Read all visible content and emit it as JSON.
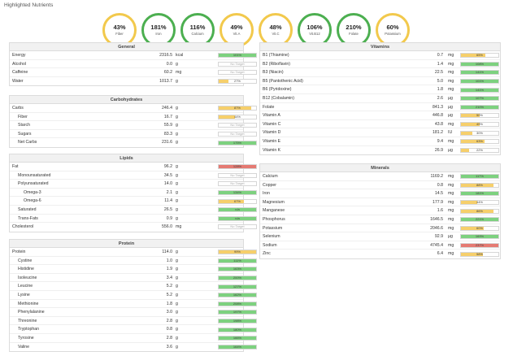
{
  "title": "Highlighted Nutrients",
  "highlights": [
    {
      "pct": "43%",
      "name": "Fiber",
      "color": "#f2c94c"
    },
    {
      "pct": "181%",
      "name": "Iron",
      "color": "#4caf50"
    },
    {
      "pct": "116%",
      "name": "Calcium",
      "color": "#4caf50"
    },
    {
      "pct": "49%",
      "name": "Vit.A",
      "color": "#f2c94c"
    },
    {
      "pct": "48%",
      "name": "Vit.C",
      "color": "#f2c94c"
    },
    {
      "pct": "106%",
      "name": "Vit.B12",
      "color": "#4caf50"
    },
    {
      "pct": "210%",
      "name": "Folate",
      "color": "#4caf50"
    },
    {
      "pct": "60%",
      "name": "Potassium",
      "color": "#f2c94c"
    }
  ],
  "sections": {
    "general": {
      "title": "General",
      "rows": [
        {
          "name": "Energy",
          "amount": "2316.5",
          "unit": "kcal",
          "pct": 101,
          "bar": "101%",
          "status": "green",
          "indent": 0
        },
        {
          "name": "Alcohol",
          "amount": "0.0",
          "unit": "g",
          "pct": 0,
          "bar": "No Target",
          "status": "none",
          "indent": 0
        },
        {
          "name": "Caffeine",
          "amount": "60.2",
          "unit": "mg",
          "pct": 0,
          "bar": "No Target",
          "status": "none",
          "indent": 0
        },
        {
          "name": "Water",
          "amount": "1013.7",
          "unit": "g",
          "pct": 27,
          "bar": "27%",
          "status": "yellow",
          "indent": 0
        }
      ]
    },
    "carbohydrates": {
      "title": "Carbohydrates",
      "rows": [
        {
          "name": "Carbs",
          "amount": "246.4",
          "unit": "g",
          "pct": 87,
          "bar": "87%",
          "status": "yellow",
          "indent": 0
        },
        {
          "name": "Fiber",
          "amount": "16.7",
          "unit": "g",
          "pct": 44,
          "bar": "44%",
          "status": "yellow",
          "indent": 1
        },
        {
          "name": "Starch",
          "amount": "55.9",
          "unit": "g",
          "pct": 0,
          "bar": "No Target",
          "status": "none",
          "indent": 1
        },
        {
          "name": "Sugars",
          "amount": "83.3",
          "unit": "g",
          "pct": 0,
          "bar": "No Target",
          "status": "none",
          "indent": 1
        },
        {
          "name": "Net Carbs",
          "amount": "231.6",
          "unit": "g",
          "pct": 100,
          "bar": "175%",
          "status": "green",
          "indent": 1
        }
      ]
    },
    "lipids": {
      "title": "Lipids",
      "rows": [
        {
          "name": "Fat",
          "amount": "96.2",
          "unit": "g",
          "pct": 100,
          "bar": "128%",
          "status": "red",
          "indent": 0
        },
        {
          "name": "Monounsaturated",
          "amount": "34.5",
          "unit": "g",
          "pct": 0,
          "bar": "No Target",
          "status": "none",
          "indent": 1
        },
        {
          "name": "Polyunsaturated",
          "amount": "14.0",
          "unit": "g",
          "pct": 0,
          "bar": "No Target",
          "status": "none",
          "indent": 1
        },
        {
          "name": "Omega-3",
          "amount": "2.1",
          "unit": "g",
          "pct": 100,
          "bar": "134%",
          "status": "green",
          "indent": 2
        },
        {
          "name": "Omega-6",
          "amount": "11.4",
          "unit": "g",
          "pct": 67,
          "bar": "67%",
          "status": "yellow",
          "indent": 2
        },
        {
          "name": "Saturated",
          "amount": "26.5",
          "unit": "g",
          "pct": 100,
          "bar": "n/a",
          "status": "green",
          "indent": 1
        },
        {
          "name": "Trans-Fats",
          "amount": "0.9",
          "unit": "g",
          "pct": 100,
          "bar": "n/a",
          "status": "green",
          "indent": 1
        },
        {
          "name": "Cholesterol",
          "amount": "556.0",
          "unit": "mg",
          "pct": 0,
          "bar": "No Target",
          "status": "none",
          "indent": 0
        }
      ]
    },
    "protein": {
      "title": "Protein",
      "rows": [
        {
          "name": "Protein",
          "amount": "114.0",
          "unit": "g",
          "pct": 99,
          "bar": "99%",
          "status": "yellow",
          "indent": 0
        },
        {
          "name": "Cystine",
          "amount": "1.0",
          "unit": "g",
          "pct": 100,
          "bar": "111%",
          "status": "green",
          "indent": 1
        },
        {
          "name": "Histidine",
          "amount": "1.9",
          "unit": "g",
          "pct": 100,
          "bar": "163%",
          "status": "green",
          "indent": 1
        },
        {
          "name": "Isoleucine",
          "amount": "3.4",
          "unit": "g",
          "pct": 100,
          "bar": "200%",
          "status": "green",
          "indent": 1
        },
        {
          "name": "Leucine",
          "amount": "5.2",
          "unit": "g",
          "pct": 100,
          "bar": "127%",
          "status": "green",
          "indent": 1
        },
        {
          "name": "Lysine",
          "amount": "5.2",
          "unit": "g",
          "pct": 100,
          "bar": "162%",
          "status": "green",
          "indent": 1
        },
        {
          "name": "Methionine",
          "amount": "1.8",
          "unit": "g",
          "pct": 100,
          "bar": "208%",
          "status": "green",
          "indent": 1
        },
        {
          "name": "Phenylalanine",
          "amount": "3.0",
          "unit": "g",
          "pct": 100,
          "bar": "197%",
          "status": "green",
          "indent": 1
        },
        {
          "name": "Threonine",
          "amount": "2.8",
          "unit": "g",
          "pct": 100,
          "bar": "198%",
          "status": "green",
          "indent": 1
        },
        {
          "name": "Tryptophan",
          "amount": "0.8",
          "unit": "g",
          "pct": 100,
          "bar": "180%",
          "status": "green",
          "indent": 1
        },
        {
          "name": "Tyrosine",
          "amount": "2.8",
          "unit": "g",
          "pct": 100,
          "bar": "166%",
          "status": "green",
          "indent": 1
        },
        {
          "name": "Valine",
          "amount": "3.6",
          "unit": "g",
          "pct": 100,
          "bar": "164%",
          "status": "green",
          "indent": 1
        }
      ]
    },
    "vitamins": {
      "title": "Vitamins",
      "rows": [
        {
          "name": "B1 (Thiamine)",
          "amount": "0.7",
          "unit": "mg",
          "pct": 65,
          "bar": "65%",
          "status": "yellow",
          "indent": 0
        },
        {
          "name": "B2 (Riboflavin)",
          "amount": "1.4",
          "unit": "mg",
          "pct": 100,
          "bar": "108%",
          "status": "green",
          "indent": 0
        },
        {
          "name": "B3 (Niacin)",
          "amount": "22.5",
          "unit": "mg",
          "pct": 100,
          "bar": "141%",
          "status": "green",
          "indent": 0
        },
        {
          "name": "B5 (Pantothenic Acid)",
          "amount": "5.0",
          "unit": "mg",
          "pct": 100,
          "bar": "101%",
          "status": "green",
          "indent": 0
        },
        {
          "name": "B6 (Pyridoxine)",
          "amount": "1.8",
          "unit": "mg",
          "pct": 100,
          "bar": "141%",
          "status": "green",
          "indent": 0
        },
        {
          "name": "B12 (Cobalamin)",
          "amount": "2.6",
          "unit": "µg",
          "pct": 100,
          "bar": "107%",
          "status": "green",
          "indent": 0
        },
        {
          "name": "Folate",
          "amount": "841.3",
          "unit": "µg",
          "pct": 100,
          "bar": "210%",
          "status": "green",
          "indent": 0
        },
        {
          "name": "Vitamin A",
          "amount": "446.8",
          "unit": "µg",
          "pct": 50,
          "bar": "50%",
          "status": "yellow",
          "indent": 0
        },
        {
          "name": "Vitamin C",
          "amount": "43.8",
          "unit": "mg",
          "pct": 49,
          "bar": "49%",
          "status": "yellow",
          "indent": 0
        },
        {
          "name": "Vitamin D",
          "amount": "181.2",
          "unit": "IU",
          "pct": 30,
          "bar": "30%",
          "status": "yellow",
          "indent": 0
        },
        {
          "name": "Vitamin E",
          "amount": "9.4",
          "unit": "mg",
          "pct": 63,
          "bar": "63%",
          "status": "yellow",
          "indent": 0
        },
        {
          "name": "Vitamin K",
          "amount": "26.9",
          "unit": "µg",
          "pct": 22,
          "bar": "22%",
          "status": "yellow",
          "indent": 0
        }
      ]
    },
    "minerals": {
      "title": "Minerals",
      "rows": [
        {
          "name": "Calcium",
          "amount": "1169.2",
          "unit": "mg",
          "pct": 100,
          "bar": "117%",
          "status": "green",
          "indent": 0
        },
        {
          "name": "Copper",
          "amount": "0.8",
          "unit": "mg",
          "pct": 88,
          "bar": "88%",
          "status": "yellow",
          "indent": 0
        },
        {
          "name": "Iron",
          "amount": "14.5",
          "unit": "mg",
          "pct": 100,
          "bar": "181%",
          "status": "green",
          "indent": 0
        },
        {
          "name": "Magnesium",
          "amount": "177.9",
          "unit": "mg",
          "pct": 44,
          "bar": "44%",
          "status": "yellow",
          "indent": 0
        },
        {
          "name": "Manganese",
          "amount": "1.6",
          "unit": "mg",
          "pct": 86,
          "bar": "86%",
          "status": "yellow",
          "indent": 0
        },
        {
          "name": "Phosphorus",
          "amount": "1646.5",
          "unit": "mg",
          "pct": 100,
          "bar": "221%",
          "status": "green",
          "indent": 0
        },
        {
          "name": "Potassium",
          "amount": "2046.6",
          "unit": "mg",
          "pct": 60,
          "bar": "60%",
          "status": "yellow",
          "indent": 0
        },
        {
          "name": "Selenium",
          "amount": "92.9",
          "unit": "µg",
          "pct": 100,
          "bar": "169%",
          "status": "green",
          "indent": 0
        },
        {
          "name": "Sodium",
          "amount": "4745.4",
          "unit": "mg",
          "pct": 100,
          "bar": "237%",
          "status": "red",
          "indent": 0
        },
        {
          "name": "Zinc",
          "amount": "6.4",
          "unit": "mg",
          "pct": 58,
          "bar": "58%",
          "status": "yellow",
          "indent": 0
        }
      ]
    }
  },
  "colors": {
    "green": "#7dd17f",
    "yellow": "#f6cf6b",
    "red": "#e57a72",
    "none": "#ffffff"
  }
}
